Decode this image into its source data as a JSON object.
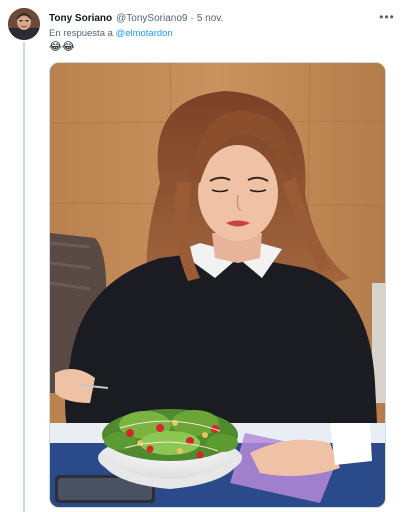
{
  "tweet": {
    "author_name": "Tony Soriano",
    "author_handle": "@TonySoriano9",
    "separator": "·",
    "timestamp": "5 nov.",
    "reply_prefix": "En respuesta a",
    "reply_mention": "@elmotardon",
    "text": "😂😂",
    "more_icon": "more-horizontal-icon"
  },
  "colors": {
    "link": "#1d9bf0",
    "secondary_text": "#536471",
    "primary_text": "#0f1419",
    "border": "#cfd9de"
  }
}
